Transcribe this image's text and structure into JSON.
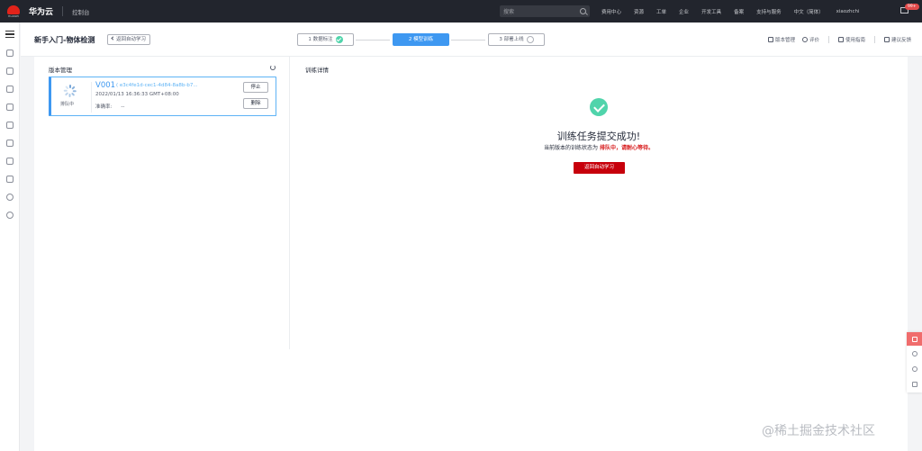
{
  "topbar": {
    "brand": "华为云",
    "logo_text": "HUAWEI",
    "console": "控制台",
    "search_placeholder": "搜索",
    "nav": [
      "费用中心",
      "资源",
      "工单",
      "企业",
      "开发工具",
      "备案",
      "支持与服务",
      "中文（简体）",
      "xiaozhchi"
    ],
    "message_badge": "99+"
  },
  "header": {
    "title": "新手入门-物体检测",
    "back_label": "返回自动学习",
    "steps": [
      {
        "label": "1 数据标注",
        "state": "done"
      },
      {
        "label": "2 模型训练",
        "state": "active"
      },
      {
        "label": "3 部署上线",
        "state": "pending"
      }
    ],
    "actions": {
      "version_mgmt": "版本管理",
      "rating": "评价",
      "guide": "使用指南",
      "feedback": "建议反馈"
    }
  },
  "version_panel": {
    "title": "版本管理",
    "card": {
      "status": "排队中",
      "version": "V001",
      "id": "( e3c4fe1d-cec1-4d84-8a8b-b7...",
      "time": "2022/01/13 16:36:33 GMT+08:00",
      "accuracy_label": "准确率:",
      "accuracy_value": "--",
      "stop_label": "停止",
      "delete_label": "删除"
    }
  },
  "details": {
    "title": "训练详情",
    "success_title": "训练任务提交成功!",
    "status_prefix": "当前版本的训练状态为",
    "status_highlight": "排队中，请耐心等待。",
    "return_label": "返回自动学习"
  },
  "watermark": "@稀土掘金技术社区",
  "colors": {
    "topbar": "#22252d",
    "accent": "#3e98f1",
    "success": "#50d4ab",
    "brand_red": "#c7000b",
    "highlight_red": "#d71a1b"
  }
}
